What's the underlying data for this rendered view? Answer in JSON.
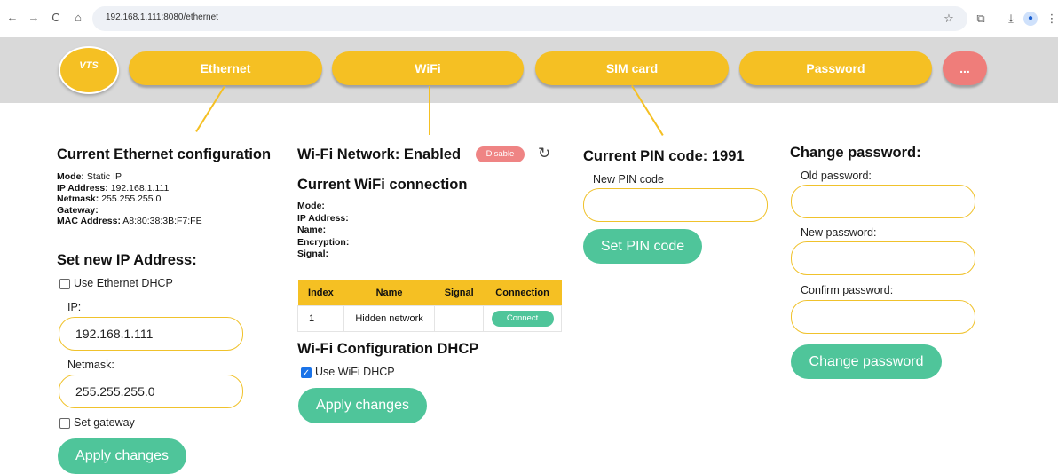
{
  "browser": {
    "back_icon": "←",
    "forward_icon": "→",
    "reload_icon": "C",
    "home_icon": "⌂",
    "url": "192.168.1.111:8080/ethernet",
    "star_icon": "☆",
    "extensions_icon": "⧉",
    "download_icon": "⤓",
    "profile_icon": "●",
    "menu_icon": "⋮"
  },
  "header": {
    "logo_text": "VTS",
    "tabs": [
      {
        "label": "Ethernet"
      },
      {
        "label": "WiFi"
      },
      {
        "label": "SIM card"
      },
      {
        "label": "Password"
      },
      {
        "label": "..."
      }
    ],
    "colors": {
      "tab": "#f5c023",
      "more": "#ef7d7a",
      "header_bg": "#d9d9d9"
    }
  },
  "ethernet": {
    "title": "Current Ethernet configuration",
    "mode_key": "Mode:",
    "mode_val": "Static IP",
    "ip_key": "IP Address:",
    "ip_val": "192.168.1.111",
    "netmask_key": "Netmask:",
    "netmask_val": "255.255.255.0",
    "gateway_key": "Gateway:",
    "gateway_val": "",
    "mac_key": "MAC Address:",
    "mac_val": "A8:80:38:3B:F7:FE",
    "set_title": "Set new IP Address:",
    "dhcp_label": "Use Ethernet DHCP",
    "dhcp_checked": false,
    "ip_label": "IP:",
    "ip_value": "192.168.1.111",
    "netmask_label": "Netmask:",
    "netmask_value": "255.255.255.0",
    "gateway_label": "Set gateway",
    "gateway_checked": false,
    "apply_label": "Apply changes"
  },
  "wifi": {
    "status_title": "Wi-Fi Network: Enabled",
    "disable_label": "Disable",
    "refresh_icon": "↻",
    "current_title": "Current WiFi connection",
    "mode_key": "Mode:",
    "ip_key": "IP Address:",
    "name_key": "Name:",
    "encryption_key": "Encryption:",
    "signal_key": "Signal:",
    "table": {
      "headers": [
        "Index",
        "Name",
        "Signal",
        "Connection"
      ],
      "rows": [
        {
          "index": "1",
          "name": "Hidden network",
          "signal": "",
          "action": "Connect"
        }
      ]
    },
    "dhcp_title": "Wi-Fi Configuration DHCP",
    "dhcp_label": "Use WiFi DHCP",
    "dhcp_checked": true,
    "check_mark": "✓",
    "apply_label": "Apply changes"
  },
  "sim": {
    "title": "Current PIN code: 1991",
    "pin_label": "New PIN code",
    "pin_value": "",
    "set_label": "Set PIN code"
  },
  "password": {
    "title": "Change password:",
    "old_label": "Old password:",
    "new_label": "New password:",
    "confirm_label": "Confirm password:",
    "submit_label": "Change password"
  },
  "colors": {
    "accent_green": "#4fc59a",
    "field_border": "#f0c22c",
    "disable_red": "#ef8484"
  }
}
